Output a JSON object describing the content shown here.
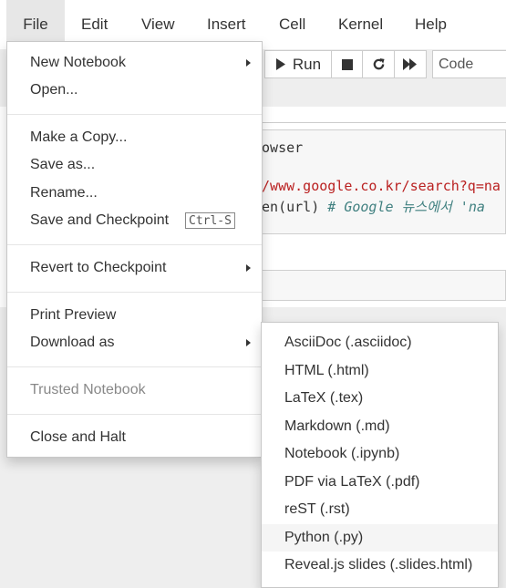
{
  "menubar": {
    "items": [
      {
        "label": "File"
      },
      {
        "label": "Edit"
      },
      {
        "label": "View"
      },
      {
        "label": "Insert"
      },
      {
        "label": "Cell"
      },
      {
        "label": "Kernel"
      },
      {
        "label": "Help"
      }
    ]
  },
  "toolbar": {
    "run_label": "Run",
    "cell_type": "Code"
  },
  "code": {
    "line1": "rowser",
    "line2": "//www.google.co.kr/search?q=na",
    "line3a": "pen(url) ",
    "line3b": "# Google 뉴스에서 'na"
  },
  "file_menu": {
    "new_notebook": "New Notebook",
    "open": "Open...",
    "make_copy": "Make a Copy...",
    "save_as": "Save as...",
    "rename": "Rename...",
    "save_checkpoint": "Save and Checkpoint",
    "save_shortcut": "Ctrl-S",
    "revert": "Revert to Checkpoint",
    "print_preview": "Print Preview",
    "download_as": "Download as",
    "trusted": "Trusted Notebook",
    "close_halt": "Close and Halt"
  },
  "download_menu": {
    "items": [
      {
        "label": "AsciiDoc (.asciidoc)"
      },
      {
        "label": "HTML (.html)"
      },
      {
        "label": "LaTeX (.tex)"
      },
      {
        "label": "Markdown (.md)"
      },
      {
        "label": "Notebook (.ipynb)"
      },
      {
        "label": "PDF via LaTeX (.pdf)"
      },
      {
        "label": "reST (.rst)"
      },
      {
        "label": "Python (.py)"
      },
      {
        "label": "Reveal.js slides (.slides.html)"
      }
    ]
  },
  "colors": {
    "code_string": "#ba2121",
    "code_comment": "#408080",
    "code_text": "#333333"
  }
}
